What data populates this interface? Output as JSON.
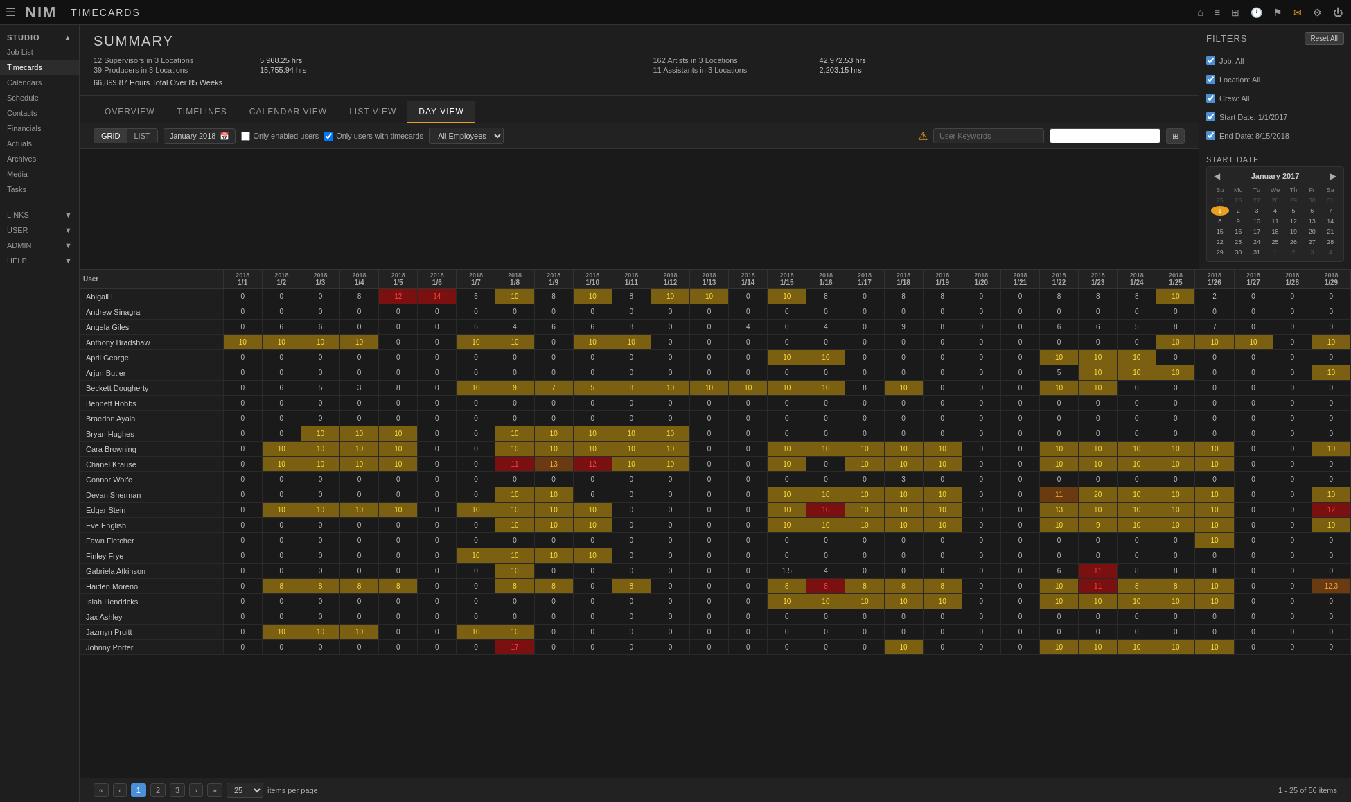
{
  "topbar": {
    "logo": "NIM",
    "title": "TIMECARDS",
    "icons": [
      "home",
      "list",
      "grid",
      "clock",
      "bookmark",
      "mail",
      "gear",
      "power"
    ]
  },
  "sidebar": {
    "studio_label": "STUDIO",
    "studio_items": [
      "Job List",
      "Timecards",
      "Calendars",
      "Schedule",
      "Contacts",
      "Financials",
      "Actuals",
      "Archives",
      "Media",
      "Tasks"
    ],
    "active_item": "Timecards",
    "links_label": "LINKS",
    "user_label": "USER",
    "admin_label": "ADMIN",
    "help_label": "HELP"
  },
  "summary": {
    "title": "SUMMARY",
    "rows": [
      {
        "label": "12 Supervisors in 3 Locations",
        "value": "5,968.25 hrs"
      },
      {
        "label": "162 Artists in 3 Locations",
        "value": "42,972.53 hrs"
      },
      {
        "label": "39 Producers in 3 Locations",
        "value": "15,755.94 hrs"
      },
      {
        "label": "11 Assistants in 3 Locations",
        "value": "2,203.15 hrs"
      }
    ],
    "total": "66,899.87 Hours Total Over 85 Weeks"
  },
  "view_tabs": [
    "OVERVIEW",
    "TIMELINES",
    "CALENDAR VIEW",
    "LIST VIEW",
    "DAY VIEW"
  ],
  "active_tab": "DAY VIEW",
  "toolbar": {
    "grid_label": "GRID",
    "list_label": "LIST",
    "month": "January 2018",
    "only_enabled_label": "Only enabled users",
    "only_timecards_label": "Only users with timecards",
    "employee_filter": "All Employees",
    "search_placeholder": "User Keywords",
    "search2_placeholder": ""
  },
  "filters": {
    "title": "FILTERS",
    "reset_label": "Reset All",
    "items": [
      {
        "label": "Job: All",
        "checked": true
      },
      {
        "label": "Location: All",
        "checked": true
      },
      {
        "label": "Crew: All",
        "checked": true
      },
      {
        "label": "Start Date: 1/1/2017",
        "checked": true
      },
      {
        "label": "End Date: 8/15/2018",
        "checked": true
      }
    ]
  },
  "mini_calendar": {
    "title": "January 2017",
    "prev": "◀",
    "next": "▶",
    "start_date_label": "START DATE",
    "day_headers": [
      "Su",
      "Mo",
      "Tu",
      "We",
      "Th",
      "Fr",
      "Sa"
    ],
    "weeks": [
      [
        "25",
        "26",
        "27",
        "28",
        "29",
        "30",
        "31"
      ],
      [
        "1",
        "2",
        "3",
        "4",
        "5",
        "6",
        "7"
      ],
      [
        "8",
        "9",
        "10",
        "11",
        "12",
        "13",
        "14"
      ],
      [
        "15",
        "16",
        "17",
        "18",
        "19",
        "20",
        "21"
      ],
      [
        "22",
        "23",
        "24",
        "25",
        "26",
        "27",
        "28"
      ],
      [
        "29",
        "30",
        "31",
        "1",
        "2",
        "3",
        "4"
      ]
    ],
    "selected_day": "1"
  },
  "table": {
    "user_col": "User",
    "date_cols": [
      {
        "top": "2018",
        "bottom": "1/1"
      },
      {
        "top": "2018",
        "bottom": "1/2"
      },
      {
        "top": "2018",
        "bottom": "1/3"
      },
      {
        "top": "2018",
        "bottom": "1/4"
      },
      {
        "top": "2018",
        "bottom": "1/5"
      },
      {
        "top": "2018",
        "bottom": "1/6"
      },
      {
        "top": "2018",
        "bottom": "1/7"
      },
      {
        "top": "2018",
        "bottom": "1/8"
      },
      {
        "top": "2018",
        "bottom": "1/9"
      },
      {
        "top": "2018",
        "bottom": "1/10"
      },
      {
        "top": "2018",
        "bottom": "1/11"
      },
      {
        "top": "2018",
        "bottom": "1/12"
      },
      {
        "top": "2018",
        "bottom": "1/13"
      },
      {
        "top": "2018",
        "bottom": "1/14"
      },
      {
        "top": "2018",
        "bottom": "1/15"
      },
      {
        "top": "2018",
        "bottom": "1/16"
      },
      {
        "top": "2018",
        "bottom": "1/17"
      },
      {
        "top": "2018",
        "bottom": "1/18"
      },
      {
        "top": "2018",
        "bottom": "1/19"
      },
      {
        "top": "2018",
        "bottom": "1/20"
      },
      {
        "top": "2018",
        "bottom": "1/21"
      },
      {
        "top": "2018",
        "bottom": "1/22"
      },
      {
        "top": "2018",
        "bottom": "1/23"
      },
      {
        "top": "2018",
        "bottom": "1/24"
      },
      {
        "top": "2018",
        "bottom": "1/25"
      },
      {
        "top": "2018",
        "bottom": "1/26"
      },
      {
        "top": "2018",
        "bottom": "1/27"
      },
      {
        "top": "2018",
        "bottom": "1/28"
      },
      {
        "top": "2018",
        "bottom": "1/29"
      }
    ],
    "rows": [
      {
        "name": "Abigail Li",
        "cells": [
          "0",
          "0",
          "0",
          "8",
          "12",
          "14",
          "6",
          "10",
          "8",
          "10",
          "8",
          "10",
          "10",
          "0",
          "10",
          "8",
          "0",
          "8",
          "8",
          "0",
          "0",
          "8",
          "8",
          "8",
          "10",
          "2",
          "",
          "",
          ""
        ]
      },
      {
        "name": "Andrew Sinagra",
        "cells": [
          "0",
          "0",
          "0",
          "0",
          "0",
          "0",
          "0",
          "0",
          "0",
          "0",
          "0",
          "0",
          "0",
          "0",
          "0",
          "0",
          "0",
          "0",
          "0",
          "0",
          "0",
          "0",
          "0",
          "0",
          "0",
          "0",
          "0",
          "0",
          "0"
        ]
      },
      {
        "name": "Angela Giles",
        "cells": [
          "0",
          "6",
          "6",
          "0",
          "0",
          "0",
          "6",
          "4",
          "6",
          "6",
          "8",
          "0",
          "0",
          "4",
          "0",
          "4",
          "0",
          "9",
          "8",
          "0",
          "0",
          "6",
          "6",
          "5",
          "8",
          "7",
          "",
          "",
          ""
        ]
      },
      {
        "name": "Anthony Bradshaw",
        "cells": [
          "10",
          "10",
          "10",
          "10",
          "0",
          "0",
          "10",
          "10",
          "0",
          "10",
          "10",
          "0",
          "0",
          "0",
          "0",
          "0",
          "0",
          "0",
          "0",
          "0",
          "0",
          "0",
          "0",
          "0",
          "10",
          "10",
          "10",
          "",
          "10"
        ]
      },
      {
        "name": "April George",
        "cells": [
          "0",
          "0",
          "0",
          "0",
          "0",
          "0",
          "0",
          "0",
          "0",
          "0",
          "0",
          "0",
          "0",
          "0",
          "10",
          "10",
          "0",
          "0",
          "0",
          "0",
          "0",
          "10",
          "10",
          "10",
          "0",
          "0",
          "",
          "",
          ""
        ]
      },
      {
        "name": "Arjun Butler",
        "cells": [
          "0",
          "0",
          "0",
          "0",
          "0",
          "0",
          "0",
          "0",
          "0",
          "0",
          "0",
          "0",
          "0",
          "0",
          "0",
          "0",
          "0",
          "0",
          "0",
          "0",
          "0",
          "5",
          "10",
          "10",
          "10",
          "0",
          "",
          "",
          "10"
        ]
      },
      {
        "name": "Beckett Dougherty",
        "cells": [
          "0",
          "6",
          "5",
          "3",
          "8",
          "0",
          "10",
          "9",
          "7",
          "5",
          "8",
          "10",
          "10",
          "10",
          "10",
          "10",
          "8",
          "10",
          "0",
          "0",
          "0",
          "10",
          "10",
          "0",
          "0",
          "0",
          "",
          "",
          ""
        ]
      },
      {
        "name": "Bennett Hobbs",
        "cells": [
          "0",
          "0",
          "0",
          "0",
          "0",
          "0",
          "0",
          "0",
          "0",
          "0",
          "0",
          "0",
          "0",
          "0",
          "0",
          "0",
          "0",
          "0",
          "0",
          "0",
          "0",
          "0",
          "0",
          "0",
          "0",
          "0",
          "",
          "",
          ""
        ]
      },
      {
        "name": "Braedon Ayala",
        "cells": [
          "0",
          "0",
          "0",
          "0",
          "0",
          "0",
          "0",
          "0",
          "0",
          "0",
          "0",
          "0",
          "0",
          "0",
          "0",
          "0",
          "0",
          "0",
          "0",
          "0",
          "0",
          "0",
          "0",
          "0",
          "0",
          "0",
          "",
          "",
          ""
        ]
      },
      {
        "name": "Bryan Hughes",
        "cells": [
          "0",
          "0",
          "10",
          "10",
          "10",
          "0",
          "0",
          "10",
          "10",
          "10",
          "10",
          "10",
          "0",
          "0",
          "0",
          "0",
          "0",
          "0",
          "0",
          "0",
          "0",
          "0",
          "0",
          "0",
          "0",
          "0",
          "",
          "",
          ""
        ]
      },
      {
        "name": "Cara Browning",
        "cells": [
          "0",
          "10",
          "10",
          "10",
          "10",
          "0",
          "0",
          "10",
          "10",
          "10",
          "10",
          "10",
          "0",
          "0",
          "10",
          "10",
          "10",
          "10",
          "10",
          "0",
          "0",
          "10",
          "10",
          "10",
          "10",
          "10",
          "",
          "",
          "10"
        ]
      },
      {
        "name": "Chanel Krause",
        "cells": [
          "0",
          "10",
          "10",
          "10",
          "10",
          "0",
          "0",
          "11",
          "13",
          "12",
          "10",
          "10",
          "0",
          "0",
          "10",
          "0",
          "10",
          "10",
          "10",
          "0",
          "0",
          "10",
          "10",
          "10",
          "10",
          "10",
          "",
          "",
          ""
        ]
      },
      {
        "name": "Connor Wolfe",
        "cells": [
          "0",
          "0",
          "0",
          "0",
          "0",
          "0",
          "0",
          "0",
          "0",
          "0",
          "0",
          "0",
          "0",
          "0",
          "0",
          "0",
          "0",
          "3",
          "0",
          "0",
          "0",
          "0",
          "0",
          "0",
          "0",
          "0",
          "",
          "",
          ""
        ]
      },
      {
        "name": "Devan Sherman",
        "cells": [
          "0",
          "0",
          "0",
          "0",
          "0",
          "0",
          "0",
          "10",
          "10",
          "6",
          "0",
          "0",
          "0",
          "0",
          "10",
          "10",
          "10",
          "10",
          "10",
          "0",
          "0",
          "11",
          "20",
          "10",
          "10",
          "10",
          "",
          "",
          "10"
        ]
      },
      {
        "name": "Edgar Stein",
        "cells": [
          "0",
          "10",
          "10",
          "10",
          "10",
          "0",
          "10",
          "10",
          "10",
          "10",
          "0",
          "0",
          "0",
          "0",
          "10",
          "10",
          "10",
          "10",
          "10",
          "0",
          "0",
          "13",
          "10",
          "10",
          "10",
          "10",
          "",
          "",
          "12"
        ]
      },
      {
        "name": "Eve English",
        "cells": [
          "0",
          "0",
          "0",
          "0",
          "0",
          "0",
          "0",
          "10",
          "10",
          "10",
          "0",
          "0",
          "0",
          "0",
          "10",
          "10",
          "10",
          "10",
          "10",
          "0",
          "0",
          "10",
          "9",
          "10",
          "10",
          "10",
          "",
          "",
          "10"
        ]
      },
      {
        "name": "Fawn Fletcher",
        "cells": [
          "0",
          "0",
          "0",
          "0",
          "0",
          "0",
          "0",
          "0",
          "0",
          "0",
          "0",
          "0",
          "0",
          "0",
          "0",
          "0",
          "0",
          "0",
          "0",
          "0",
          "0",
          "0",
          "0",
          "0",
          "0",
          "10",
          "",
          "",
          ""
        ]
      },
      {
        "name": "Finley Frye",
        "cells": [
          "0",
          "0",
          "0",
          "0",
          "0",
          "0",
          "10",
          "10",
          "10",
          "10",
          "0",
          "0",
          "0",
          "0",
          "0",
          "0",
          "0",
          "0",
          "0",
          "0",
          "0",
          "0",
          "0",
          "0",
          "0",
          "0",
          "",
          "",
          ""
        ]
      },
      {
        "name": "Gabriela Atkinson",
        "cells": [
          "0",
          "0",
          "0",
          "0",
          "0",
          "0",
          "0",
          "10",
          "0",
          "0",
          "0",
          "0",
          "0",
          "0",
          "1.5",
          "4",
          "0",
          "0",
          "0",
          "0",
          "0",
          "6",
          "11",
          "8",
          "8",
          "8",
          "",
          "",
          ""
        ]
      },
      {
        "name": "Haiden Moreno",
        "cells": [
          "0",
          "8",
          "8",
          "8",
          "8",
          "0",
          "0",
          "8",
          "8",
          "0",
          "8",
          "0",
          "0",
          "0",
          "8",
          "8",
          "8",
          "8",
          "8",
          "0",
          "0",
          "10",
          "11",
          "8",
          "8",
          "10",
          "",
          "",
          "12.3"
        ]
      },
      {
        "name": "Isiah Hendricks",
        "cells": [
          "0",
          "0",
          "0",
          "0",
          "0",
          "0",
          "0",
          "0",
          "0",
          "0",
          "0",
          "0",
          "0",
          "0",
          "10",
          "10",
          "10",
          "10",
          "10",
          "0",
          "0",
          "10",
          "10",
          "10",
          "10",
          "10",
          "",
          "",
          ""
        ]
      },
      {
        "name": "Jax Ashley",
        "cells": [
          "0",
          "0",
          "0",
          "0",
          "0",
          "0",
          "0",
          "0",
          "0",
          "0",
          "0",
          "0",
          "0",
          "0",
          "0",
          "0",
          "0",
          "0",
          "0",
          "0",
          "0",
          "0",
          "0",
          "0",
          "0",
          "0",
          "",
          "",
          ""
        ]
      },
      {
        "name": "Jazmyn Pruitt",
        "cells": [
          "0",
          "10",
          "10",
          "10",
          "0",
          "0",
          "10",
          "10",
          "0",
          "0",
          "0",
          "0",
          "0",
          "0",
          "0",
          "0",
          "0",
          "0",
          "0",
          "0",
          "0",
          "0",
          "0",
          "0",
          "0",
          "0",
          "",
          "",
          ""
        ]
      },
      {
        "name": "Johnny Porter",
        "cells": [
          "0",
          "0",
          "0",
          "0",
          "0",
          "0",
          "0",
          "17",
          "0",
          "0",
          "0",
          "0",
          "0",
          "0",
          "0",
          "0",
          "0",
          "10",
          "0",
          "0",
          "0",
          "10",
          "10",
          "10",
          "10",
          "10",
          "",
          "",
          ""
        ]
      }
    ]
  },
  "pagination": {
    "first": "«",
    "prev": "‹",
    "pages": [
      "1",
      "2",
      "3"
    ],
    "next": "›",
    "last": "»",
    "active_page": "1",
    "items_per_page": "25",
    "items_label": "items per page",
    "range_info": "1 - 25 of 56 items"
  },
  "cell_styles": {
    "yellow_threshold": 10,
    "red_flag": 11,
    "highlight_special": true
  }
}
